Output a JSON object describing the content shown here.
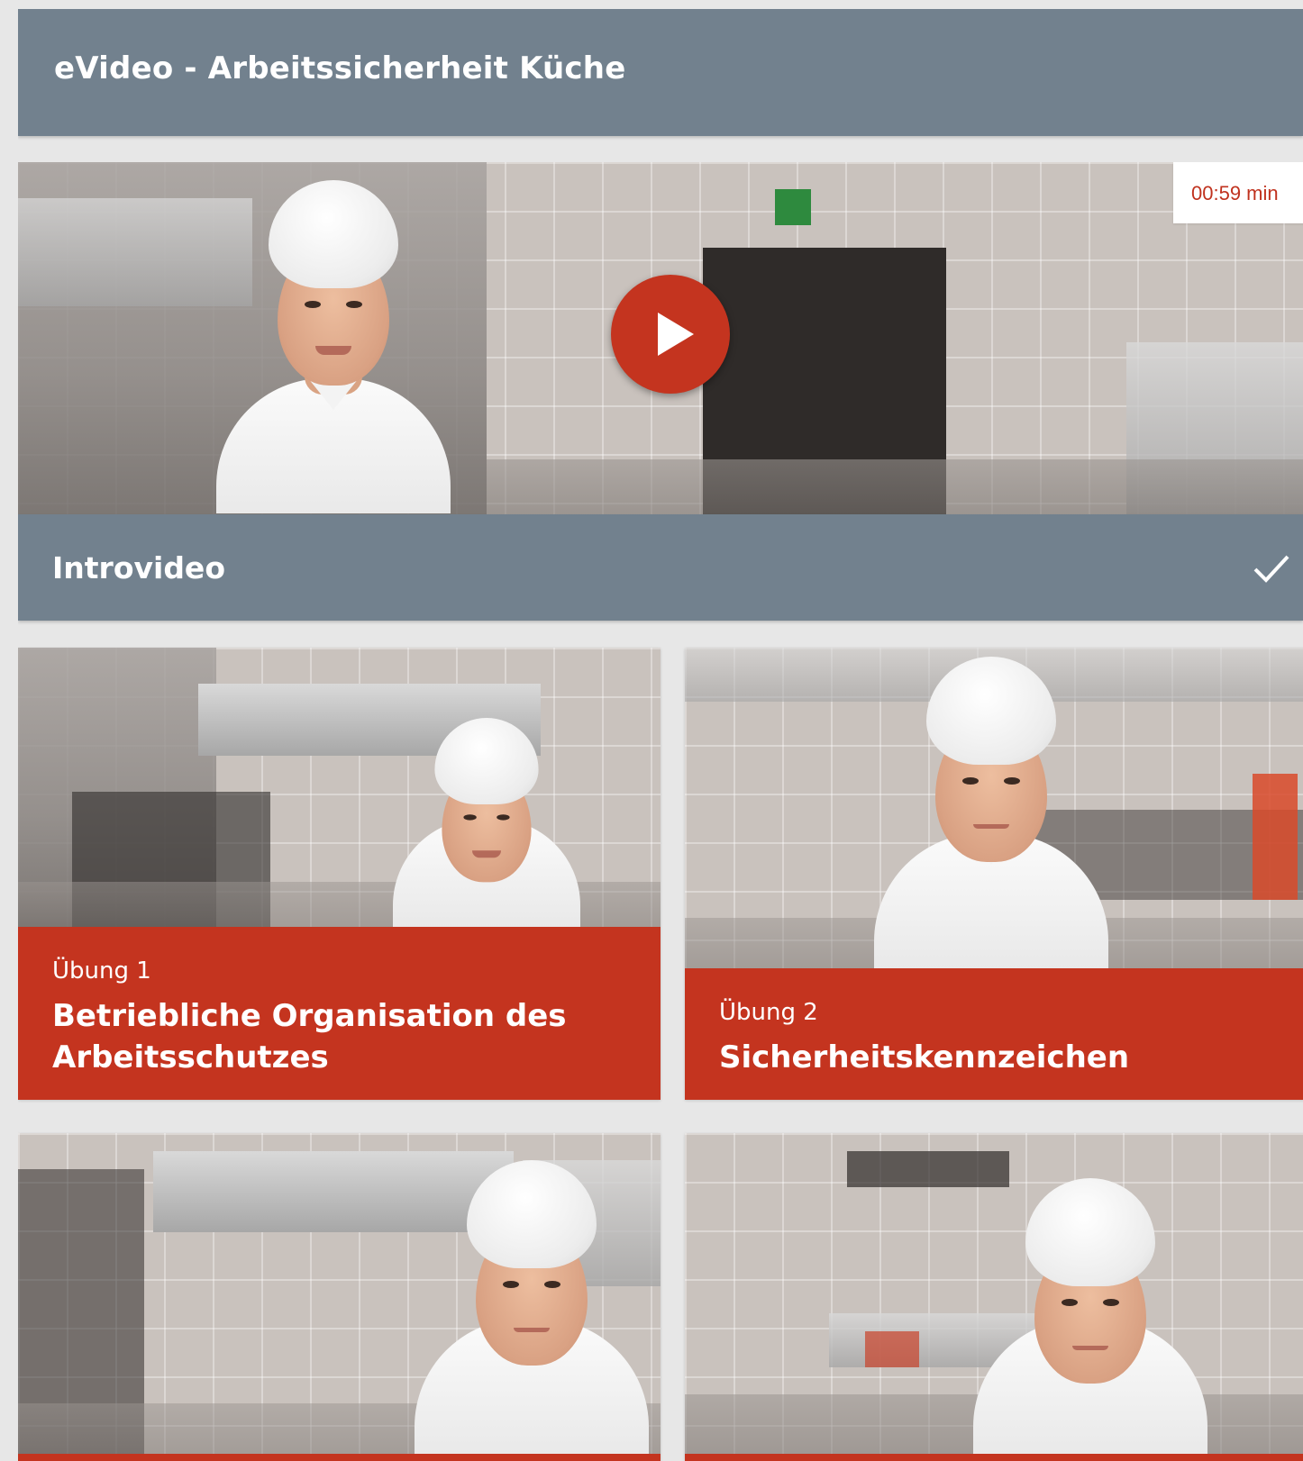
{
  "header": {
    "title": "eVideo - Arbeitssicherheit Küche"
  },
  "hero": {
    "duration": "00:59 min",
    "play_icon": "play-icon",
    "label": "Introvideo",
    "completed_icon": "checkmark-icon",
    "accent_color": "#c4341f",
    "bar_color": "#72818e"
  },
  "exercises": [
    {
      "kicker": "Übung 1",
      "title": "Betriebliche Organisation des Arbeitsschutzes"
    },
    {
      "kicker": "Übung 2",
      "title": "Sicherheitskennzeichen"
    },
    {
      "kicker": "",
      "title": ""
    },
    {
      "kicker": "",
      "title": ""
    }
  ]
}
